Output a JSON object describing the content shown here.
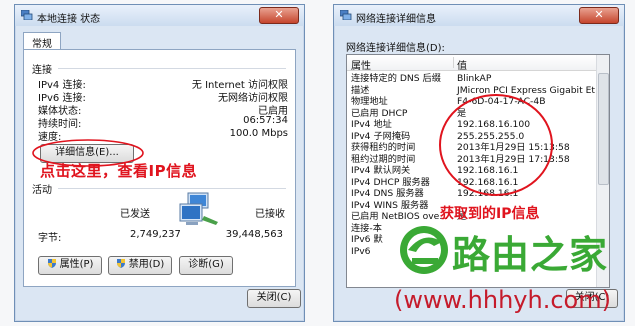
{
  "status_window": {
    "title": "本地连接 状态",
    "close_glyph": "✕",
    "tab": "常规",
    "connection_group": "连接",
    "connection_rows": [
      {
        "label": "IPv4 连接:",
        "value": "无 Internet 访问权限"
      },
      {
        "label": "IPv6 连接:",
        "value": "无网络访问权限"
      },
      {
        "label": "媒体状态:",
        "value": "已启用"
      },
      {
        "label": "持续时间:",
        "value": "06:57:34"
      },
      {
        "label": "速度:",
        "value": "100.0 Mbps"
      }
    ],
    "details_button": "详细信息(E)...",
    "annotation": "点击这里，查看IP信息",
    "activity_group": "活动",
    "sent_label": "已发送",
    "received_label": "已接收",
    "bytes_label": "字节:",
    "bytes_sent": "2,749,237",
    "bytes_received": "39,448,563",
    "properties_button": "属性(P)",
    "disable_button": "禁用(D)",
    "diagnose_button": "诊断(G)",
    "close_button": "关闭(C)"
  },
  "details_window": {
    "title": "网络连接详细信息",
    "close_glyph": "✕",
    "caption": "网络连接详细信息(D):",
    "col_property": "属性",
    "col_value": "值",
    "rows": [
      {
        "property": "连接特定的 DNS 后缀",
        "value": "BlinkAP"
      },
      {
        "property": "描述",
        "value": "JMicron PCI Express Gigabit Et"
      },
      {
        "property": "物理地址",
        "value": "F4-6D-04-17-AC-4B"
      },
      {
        "property": "已启用 DHCP",
        "value": "是"
      },
      {
        "property": "IPv4 地址",
        "value": "192.168.16.100"
      },
      {
        "property": "IPv4 子网掩码",
        "value": "255.255.255.0"
      },
      {
        "property": "获得租约的时间",
        "value": "2013年1月29日 15:13:58"
      },
      {
        "property": "租约过期的时间",
        "value": "2013年1月29日 17:13:58"
      },
      {
        "property": "IPv4 默认网关",
        "value": "192.168.16.1"
      },
      {
        "property": "IPv4 DHCP 服务器",
        "value": "192.168.16.1"
      },
      {
        "property": "IPv4 DNS 服务器",
        "value": "192.168.16.1"
      },
      {
        "property": "IPv4 WINS 服务器",
        "value": ""
      },
      {
        "property": "已启用 NetBIOS ove...",
        "value": "是"
      },
      {
        "property": "连接-本",
        "value": ""
      },
      {
        "property": "IPv6 默",
        "value": ""
      },
      {
        "property": "IPv6",
        "value": ""
      }
    ],
    "annotation": "获取到的IP信息",
    "close_button": "关闭(C)"
  },
  "watermark": {
    "brand": "路由之家",
    "url": "(www.hhhyh.com)"
  },
  "colors": {
    "annotation_red": "#e0141e",
    "logo_green": "#3aa935",
    "url_red": "#c51b2b"
  }
}
